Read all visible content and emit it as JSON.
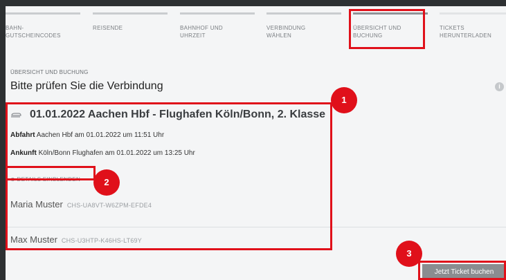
{
  "steps": [
    {
      "label": "Bahn-\nGutscheincodes"
    },
    {
      "label": "Reisende"
    },
    {
      "label": "Bahnhof und\nUhrzeit"
    },
    {
      "label": "Verbindung\nwählen"
    },
    {
      "label": "Übersicht und\nBuchung"
    },
    {
      "label": "Tickets\nherunterladen"
    }
  ],
  "section_label": "ÜBERSICHT UND BUCHUNG",
  "title": "Bitte prüfen Sie die Verbindung",
  "info_icon": "i",
  "connection": {
    "heading": "01.01.2022 Aachen Hbf - Flughafen Köln/Bonn, 2. Klasse",
    "departure_label": "Abfahrt",
    "departure_text": "Aachen Hbf am 01.01.2022 um 11:51 Uhr",
    "arrival_label": "Ankunft",
    "arrival_text": "Köln/Bonn Flughafen am 01.01.2022 um 13:25 Uhr",
    "details_link": "⊕ DETAILS EINBLENDEN"
  },
  "travelers": [
    {
      "name": "Maria Muster",
      "code": "CHS-UA8VT-W6ZPM-EFDE4"
    },
    {
      "name": "Max Muster",
      "code": "CHS-U3HTP-K46HS-LT69Y"
    }
  ],
  "book_button": "Jetzt Ticket buchen",
  "badges": [
    "1",
    "2",
    "3"
  ],
  "colors": {
    "highlight": "#e0101a",
    "background": "#2d3032",
    "panel": "#f4f5f6"
  }
}
